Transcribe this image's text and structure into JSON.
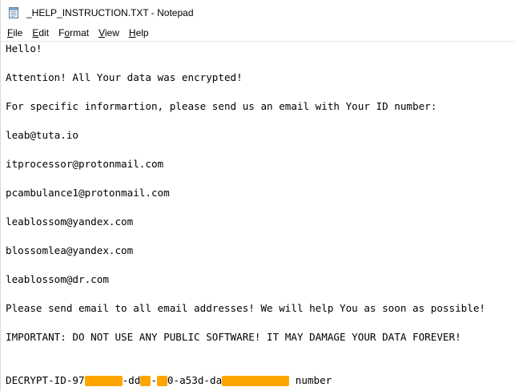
{
  "window": {
    "title": "_HELP_INSTRUCTION.TXT - Notepad"
  },
  "menu": {
    "file": {
      "accel": "F",
      "rest": "ile"
    },
    "edit": {
      "accel": "E",
      "rest": "dit"
    },
    "format": {
      "pre": "F",
      "accel": "o",
      "rest": "rmat"
    },
    "view": {
      "accel": "V",
      "rest": "iew"
    },
    "help": {
      "accel": "H",
      "rest": "elp"
    }
  },
  "document": {
    "hello": "Hello!",
    "attention": "Attention! All Your data was encrypted!",
    "instructions": "For specific informartion, please send us an email with Your ID number:",
    "emails": [
      "leab@tuta.io",
      "itprocessor@protonmail.com",
      "pcambulance1@protonmail.com",
      "leablossom@yandex.com",
      "blossomlea@yandex.com",
      "leablossom@dr.com"
    ],
    "send_all": "Please send email to all email addresses! We will help You as soon as possible!",
    "important": "IMPORTANT: DO NOT USE ANY PUBLIC SOFTWARE! IT MAY DAMAGE YOUR DATA FOREVER!",
    "decrypt_id": {
      "part1": "DECRYPT-ID-97",
      "part2": "-dd",
      "part3": "-",
      "part4": "0-a53d-da",
      "part5": " number"
    }
  },
  "colors": {
    "redaction": "#ffa500"
  }
}
